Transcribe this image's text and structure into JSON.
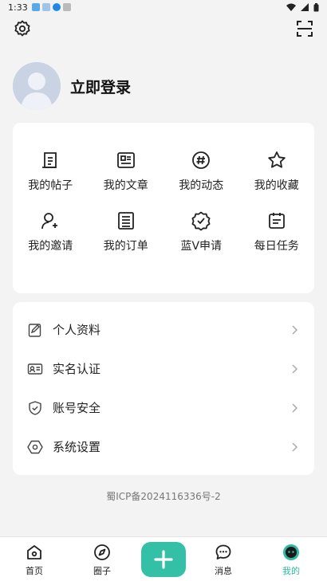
{
  "status_bar": {
    "time": "1:33"
  },
  "profile": {
    "login_label": "立即登录"
  },
  "shortcuts": [
    {
      "label": "我的帖子",
      "icon": "post-icon"
    },
    {
      "label": "我的文章",
      "icon": "article-icon"
    },
    {
      "label": "我的动态",
      "icon": "hashtag-icon"
    },
    {
      "label": "我的收藏",
      "icon": "star-icon"
    },
    {
      "label": "我的邀请",
      "icon": "invite-user-icon"
    },
    {
      "label": "我的订单",
      "icon": "order-icon"
    },
    {
      "label": "蓝V申请",
      "icon": "badge-check-icon"
    },
    {
      "label": "每日任务",
      "icon": "calendar-task-icon"
    }
  ],
  "menu": [
    {
      "label": "个人资料",
      "icon": "edit-profile-icon"
    },
    {
      "label": "实名认证",
      "icon": "id-card-icon"
    },
    {
      "label": "账号安全",
      "icon": "shield-check-icon"
    },
    {
      "label": "系统设置",
      "icon": "settings-hexagon-icon"
    }
  ],
  "icp": "蜀ICP备2024116336号-2",
  "tabbar": {
    "home": "首页",
    "circle": "圈子",
    "messages": "消息",
    "mine": "我的"
  },
  "colors": {
    "accent": "#34c0a6",
    "active_tab": "#2fb8a2"
  }
}
